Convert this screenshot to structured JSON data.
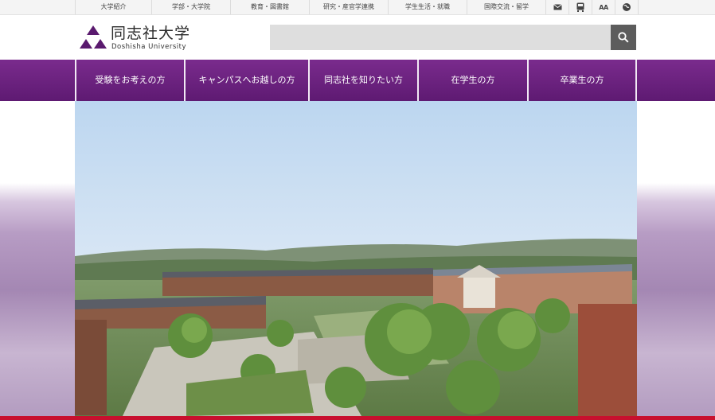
{
  "top_nav": {
    "links": [
      "大学紹介",
      "学部・大学院",
      "教育・図書館",
      "研究・産官学連携",
      "学生生活・就職",
      "国際交流・留学"
    ],
    "icons": [
      "mail-icon",
      "bus-icon",
      "font-size-icon",
      "language-icon"
    ],
    "font_size_label": "AA"
  },
  "header": {
    "logo_jp": "同志社大学",
    "logo_en": "Doshisha University",
    "search_placeholder": "",
    "search_icon": "search-icon"
  },
  "global_nav": {
    "items": [
      "受験をお考えの方",
      "キャンパスへお越しの方",
      "同志社を知りたい方",
      "在学生の方",
      "卒業生の方"
    ]
  },
  "colors": {
    "brand_purple": "#6a2080",
    "search_button": "#5c5c5c",
    "accent_red": "#c8102e"
  }
}
